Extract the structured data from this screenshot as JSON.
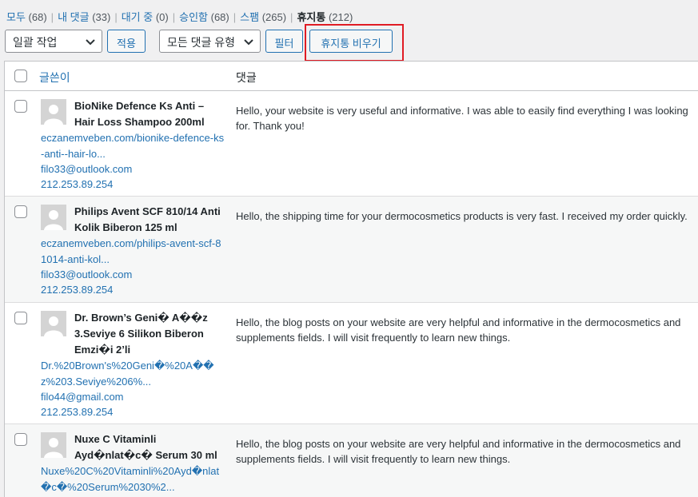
{
  "status_links": [
    {
      "label": "모두",
      "count": "(68)"
    },
    {
      "label": "내 댓글",
      "count": "(33)"
    },
    {
      "label": "대기 중",
      "count": "(0)"
    },
    {
      "label": "승인함",
      "count": "(68)"
    },
    {
      "label": "스팸",
      "count": "(265)"
    },
    {
      "label": "휴지통",
      "count": "(212)"
    }
  ],
  "tablenav": {
    "bulk_action": "일괄 작업",
    "apply": "적용",
    "comment_type": "모든 댓글 유형",
    "filter": "필터",
    "empty_trash": "휴지통 비우기"
  },
  "columns": {
    "author": "글쓴이",
    "comment": "댓글"
  },
  "comments": [
    {
      "author": "BioNike Defence Ks Anti – Hair Loss Shampoo 200ml",
      "url": "eczanemveben.com/bionike-defence-ks-anti--hair-lo...",
      "email": "filo33@outlook.com",
      "ip": "212.253.89.254",
      "text": "Hello, your website is very useful and informative. I was able to easily find everything I was looking for. Thank you!"
    },
    {
      "author": "Philips Avent SCF 810/14 Anti Kolik Biberon 125 ml",
      "url": "eczanemveben.com/philips-avent-scf-81014-anti-kol...",
      "email": "filo33@outlook.com",
      "ip": "212.253.89.254",
      "text": "Hello, the shipping time for your dermocosmetics products is very fast. I received my order quickly."
    },
    {
      "author": "Dr. Brown’s Geni� A��z 3.Seviye 6 Silikon Biberon Emzi�i 2’li",
      "url": "Dr.%20Brown's%20Geni�%20A��z%203.Seviye%206%...",
      "email": "filo44@gmail.com",
      "ip": "212.253.89.254",
      "text": "Hello, the blog posts on your website are very helpful and informative in the dermocosmetics and supplements fields. I will visit frequently to learn new things."
    },
    {
      "author": "Nuxe C Vitaminli Ayd�nlat�c� Serum 30 ml",
      "url": "Nuxe%20C%20Vitaminli%20Ayd�nlat�c�%20Serum%2030%2...",
      "email": "",
      "ip": "",
      "text": "Hello, the blog posts on your website are very helpful and informative in the dermocosmetics and supplements fields. I will visit frequently to learn new things."
    }
  ]
}
